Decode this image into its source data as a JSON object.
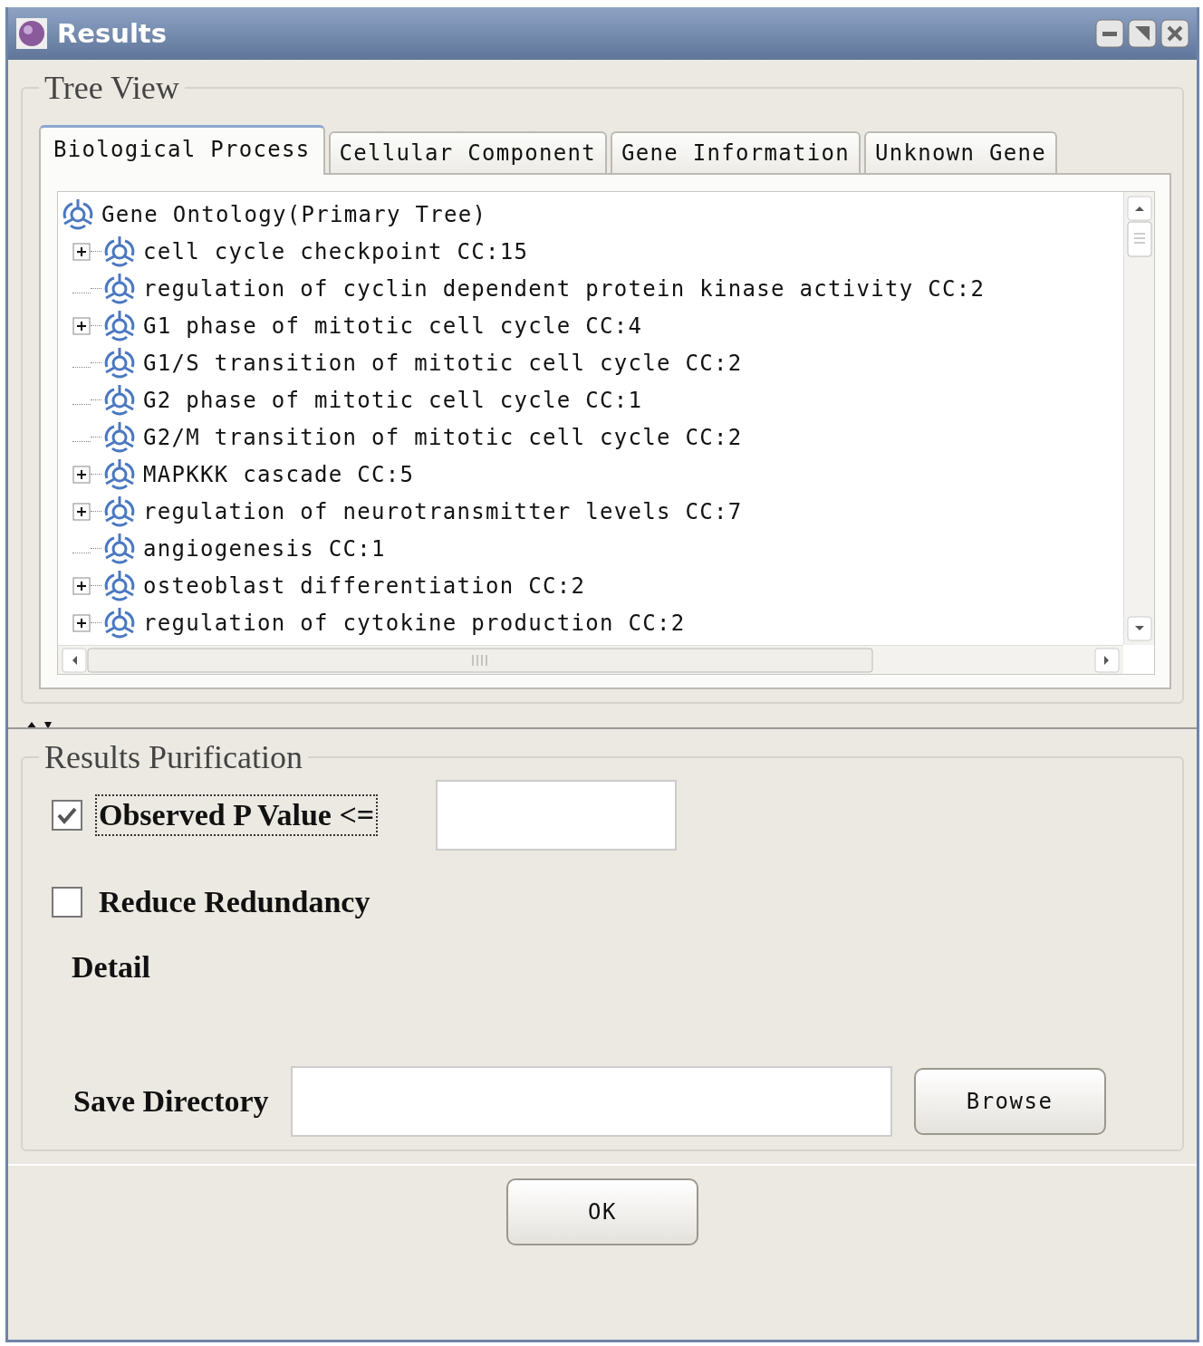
{
  "window": {
    "title": "Results"
  },
  "tree_view": {
    "title": "Tree View",
    "tabs": [
      {
        "label": "Biological Process",
        "selected": true
      },
      {
        "label": "Cellular Component",
        "selected": false
      },
      {
        "label": "Gene Information",
        "selected": false
      },
      {
        "label": "Unknown Gene",
        "selected": false
      }
    ],
    "tree": {
      "label": "Gene Ontology(Primary Tree)",
      "children": [
        {
          "label": "cell cycle checkpoint CC:15",
          "collapsed": true
        },
        {
          "label": "regulation of cyclin dependent protein kinase activity CC:2",
          "collapsed": false
        },
        {
          "label": "G1 phase of mitotic cell cycle CC:4",
          "collapsed": true
        },
        {
          "label": "G1/S transition of mitotic cell cycle CC:2",
          "collapsed": false
        },
        {
          "label": "G2 phase of mitotic cell cycle CC:1",
          "collapsed": false
        },
        {
          "label": "G2/M transition of mitotic cell cycle CC:2",
          "collapsed": false
        },
        {
          "label": "MAPKKK cascade CC:5",
          "collapsed": true
        },
        {
          "label": "regulation of neurotransmitter levels CC:7",
          "collapsed": true
        },
        {
          "label": "angiogenesis CC:1",
          "collapsed": false
        },
        {
          "label": "osteoblast differentiation CC:2",
          "collapsed": true
        },
        {
          "label": "regulation of cytokine production CC:2",
          "collapsed": true
        }
      ]
    }
  },
  "results_purification": {
    "title": "Results Purification",
    "options": [
      {
        "label": "Observed P Value <=",
        "checked": true,
        "focused": true,
        "has_field": true
      },
      {
        "label": "Reduce Redundancy",
        "checked": false,
        "focused": false,
        "has_field": false
      }
    ],
    "detail_label": "Detail",
    "save_directory": {
      "label": "Save Directory",
      "button": "Browse"
    }
  },
  "ok_button": "OK"
}
